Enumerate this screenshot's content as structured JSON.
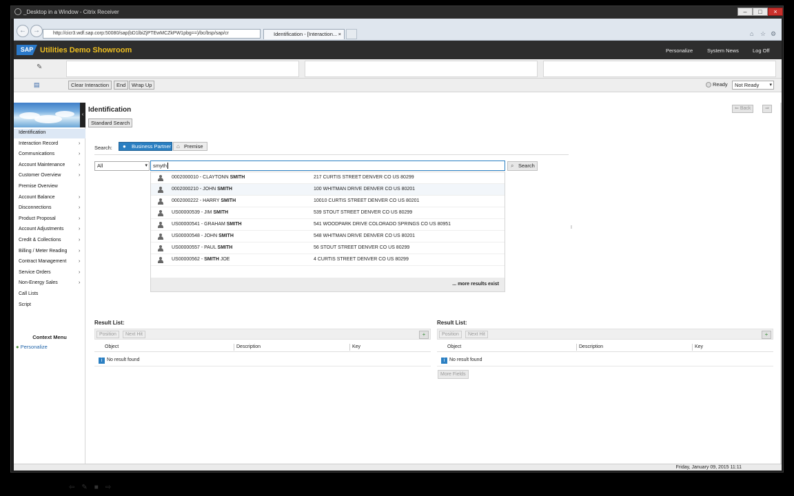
{
  "window": {
    "title": "_Desktop in a Window - Citrix Receiver"
  },
  "browser": {
    "url": "http://cicr3.wdf.sap.corp:50080/sap(bD1lbiZjPTEwMCZkPW1pbg==)/bc/bsp/sap/cr",
    "tab_title": "Identification - [Interaction...",
    "tab_close": "×"
  },
  "header": {
    "logo": "SAP",
    "app_title": "Utilities Demo Showroom",
    "links": [
      "Personalize",
      "System News",
      "Log Off"
    ]
  },
  "toolbar": {
    "buttons": [
      "Clear Interaction",
      "End",
      "Wrap Up"
    ],
    "ready_label": "Ready",
    "not_ready": "Not Ready"
  },
  "nav": {
    "items": [
      {
        "label": "Identification",
        "arrow": ""
      },
      {
        "label": "Interaction Record",
        "arrow": "›"
      },
      {
        "label": "Communications",
        "arrow": "›"
      },
      {
        "label": "Account Maintenance",
        "arrow": "›"
      },
      {
        "label": "Customer Overview",
        "arrow": "›"
      },
      {
        "label": "Premise Overview",
        "arrow": ""
      },
      {
        "label": "Account Balance",
        "arrow": "›"
      },
      {
        "label": "Disconnections",
        "arrow": "›"
      },
      {
        "label": "Product Proposal",
        "arrow": "›"
      },
      {
        "label": "Account Adjustments",
        "arrow": "›"
      },
      {
        "label": "Credit & Collections",
        "arrow": "›"
      },
      {
        "label": "Billing / Meter Reading",
        "arrow": "›"
      },
      {
        "label": "Contract Management",
        "arrow": "›"
      },
      {
        "label": "Service Orders",
        "arrow": "›"
      },
      {
        "label": "Non-Energy Sales",
        "arrow": "›"
      },
      {
        "label": "Call Lists",
        "arrow": ""
      },
      {
        "label": "Script",
        "arrow": ""
      }
    ],
    "context_menu_title": "Context Menu",
    "context_personalize": "Personalize"
  },
  "main": {
    "title": "Identification",
    "back_label": "Back",
    "standard_search": "Standard Search",
    "search_label": "Search:",
    "business_partner": "Business Partner",
    "premise": "Premise",
    "scope_value": "All",
    "query_value": "smyth",
    "search_button": "Search",
    "suggestions": [
      {
        "id": "0002000010 - CLAYTONN ",
        "bold": "SMITH",
        "address": "217 CURTIS STREET DENVER CO US 80299"
      },
      {
        "id": "0002000210 - JOHN ",
        "bold": "SMITH",
        "address": "100 WHITMAN DRIVE DENVER CO US 80201"
      },
      {
        "id": "0002000222 - HARRY ",
        "bold": "SMITH",
        "address": "10010 CURTIS STREET DENVER CO US 80201"
      },
      {
        "id": "US00000539 - JIM ",
        "bold": "SMITH",
        "address": "539 STOUT STREET DENVER CO US 80299"
      },
      {
        "id": "US00000541 - GRAHAM ",
        "bold": "SMITH",
        "address": "541 WOODPARK DRIVE COLORADO SPRINGS CO US 80951"
      },
      {
        "id": "US00000548 - JOHN ",
        "bold": "SMITH",
        "address": "548 WHITMAN DRIVE DENVER CO US 80201"
      },
      {
        "id": "US00000557 - PAUL ",
        "bold": "SMITH",
        "address": "56 STOUT STREET DENVER CO US 80299"
      },
      {
        "id": "US00000562 - ",
        "bold": "SMITH",
        "suffix": " JOE",
        "address": "4 CURTIS STREET DENVER CO US 80299"
      }
    ],
    "more_results": "... more results exist",
    "result_lists": [
      {
        "title": "Result List:",
        "position": "Position",
        "next_hit": "Next Hit",
        "cols": [
          "Object",
          "Description",
          "Key"
        ],
        "empty": "No result found"
      },
      {
        "title": "Result List:",
        "position": "Position",
        "next_hit": "Next Hit",
        "cols": [
          "Object",
          "Description",
          "Key"
        ],
        "empty": "No result found",
        "more_fields": "More Fields"
      }
    ]
  },
  "status": {
    "datetime": "Friday, January 09, 2015 11:11"
  },
  "colors": {
    "accent": "#2a7fc2",
    "header_bg": "#2d2d2d",
    "title_gold": "#f0c020"
  }
}
